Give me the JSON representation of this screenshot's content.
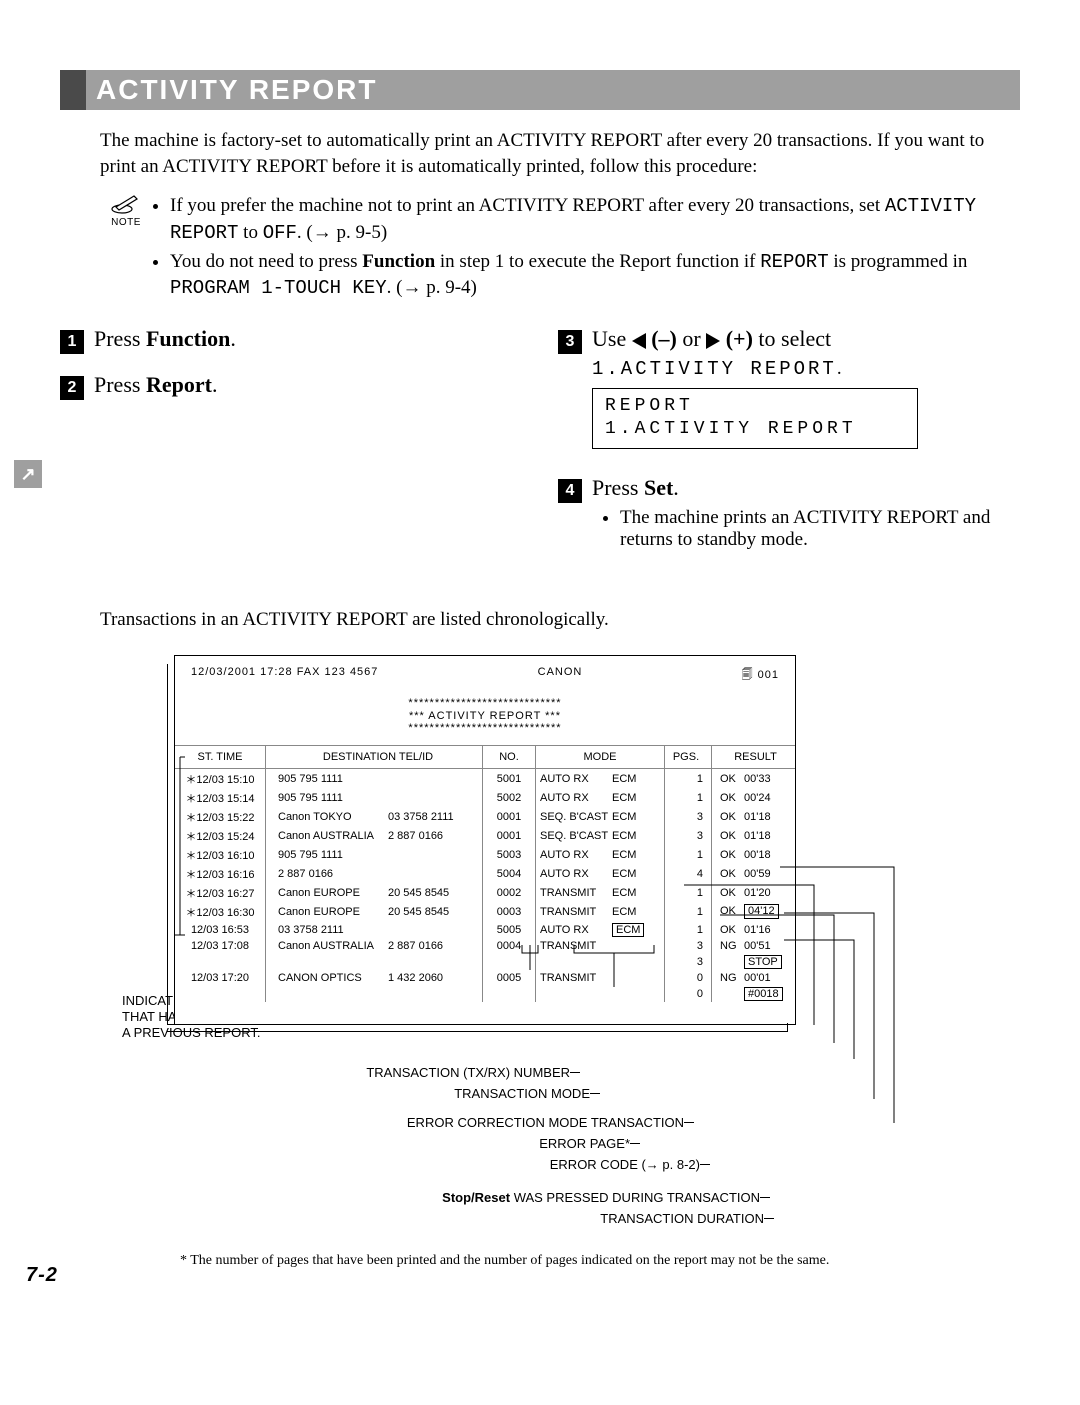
{
  "section_title": "ACTIVITY REPORT",
  "intro": "The machine is factory-set to automatically print an ACTIVITY REPORT after every 20 transactions. If you want to print an ACTIVITY REPORT before it is automatically printed, follow this procedure:",
  "note_label": "NOTE",
  "note_items": [
    {
      "pre": "If you prefer the machine not to print an ACTIVITY REPORT after every 20 transactions, set ",
      "mono": "ACTIVITY REPORT",
      "mid": " to ",
      "mono2": "OFF",
      "post": ". (→ p. 9-5)"
    },
    {
      "pre": "You do not need to press ",
      "bold": "Function",
      "mid": " in step 1 to execute the Report function if ",
      "mono": "REPORT",
      "mid2": " is programmed in ",
      "mono2": "PROGRAM 1-TOUCH KEY",
      "post": ". (→ p. 9-4)"
    }
  ],
  "steps": {
    "s1": {
      "num": "1",
      "pre": "Press ",
      "bold": "Function",
      "post": "."
    },
    "s2": {
      "num": "2",
      "pre": "Press ",
      "bold": "Report",
      "post": "."
    },
    "s3": {
      "num": "3",
      "pre": "Use ",
      "minus": "(–)",
      "or": " or ",
      "plus": "(+)",
      "post": " to select",
      "line2": "1.ACTIVITY REPORT",
      "after": "."
    },
    "s4": {
      "num": "4",
      "pre": "Press ",
      "bold": "Set",
      "post": ".",
      "bullet": "The machine prints an ACTIVITY REPORT and returns to standby mode."
    },
    "lcd_l1": "REPORT",
    "lcd_l2": " 1.ACTIVITY REPORT"
  },
  "chrono": "Transactions in an ACTIVITY REPORT are listed chronologically.",
  "report": {
    "header_left": "12/03/2001  17:28  FAX 123 4567",
    "header_mid": "CANON",
    "header_right": "001",
    "title_stars": "*****************************",
    "title_text": "***    ACTIVITY REPORT    ***",
    "columns": [
      "ST. TIME",
      "DESTINATION TEL/ID",
      "NO.",
      "MODE",
      "PGS.",
      "RESULT"
    ],
    "rows": [
      {
        "st": "＊12/03  15:10",
        "dest": "905 795 1111",
        "tel": "",
        "no": "5001",
        "mode": "AUTO RX",
        "ecm": "ECM",
        "pgs": "1",
        "res": "OK",
        "dur": "00'33"
      },
      {
        "st": "＊12/03  15:14",
        "dest": "905 795 1111",
        "tel": "",
        "no": "5002",
        "mode": "AUTO RX",
        "ecm": "ECM",
        "pgs": "1",
        "res": "OK",
        "dur": "00'24"
      },
      {
        "st": "＊12/03  15:22",
        "dest": "Canon TOKYO",
        "tel": "03 3758 2111",
        "no": "0001",
        "mode": "SEQ. B'CAST",
        "ecm": "ECM",
        "pgs": "3",
        "res": "OK",
        "dur": "01'18"
      },
      {
        "st": "＊12/03  15:24",
        "dest": "Canon AUSTRALIA",
        "tel": "2 887 0166",
        "no": "0001",
        "mode": "SEQ. B'CAST",
        "ecm": "ECM",
        "pgs": "3",
        "res": "OK",
        "dur": "01'18"
      },
      {
        "st": "＊12/03  16:10",
        "dest": "905 795 1111",
        "tel": "",
        "no": "5003",
        "mode": "AUTO RX",
        "ecm": "ECM",
        "pgs": "1",
        "res": "OK",
        "dur": "00'18"
      },
      {
        "st": "＊12/03  16:16",
        "dest": "2 887 0166",
        "tel": "",
        "no": "5004",
        "mode": "AUTO RX",
        "ecm": "ECM",
        "pgs": "4",
        "res": "OK",
        "dur": "00'59"
      },
      {
        "st": "＊12/03  16:27",
        "dest": "Canon EUROPE",
        "tel": "20 545 8545",
        "no": "0002",
        "mode": "TRANSMIT",
        "ecm": "ECM",
        "pgs": "1",
        "res": "OK",
        "dur": "01'20"
      },
      {
        "st": "＊12/03  16:30",
        "dest": "Canon EUROPE",
        "tel": "20 545 8545",
        "no": "0003",
        "mode": "TRANSMIT",
        "ecm": "ECM",
        "pgs": "1",
        "res": "OK",
        "dur": "04'12",
        "dur_boxed": true
      },
      {
        "st": "  12/03  16:53",
        "dest": "03 3758 2111",
        "tel": "",
        "no": "5005",
        "mode": "AUTO RX",
        "ecm": "ECM",
        "ecm_boxed": true,
        "pgs": "1",
        "res": "OK",
        "dur": "01'16"
      },
      {
        "st": "  12/03  17:08",
        "dest": "Canon AUSTRALIA",
        "tel": "2 887 0166",
        "no": "0004",
        "mode": "TRANSMIT",
        "ecm": "",
        "pgs": "3",
        "res": "NG",
        "dur": "00'51"
      },
      {
        "st": "",
        "dest": "",
        "tel": "",
        "no": "",
        "mode": "",
        "ecm": "",
        "pgs": "3",
        "res": "",
        "dur": "STOP",
        "dur_boxed": true
      },
      {
        "st": "  12/03  17:20",
        "dest": "CANON OPTICS",
        "tel": "1 432 2060",
        "no": "0005",
        "mode": "TRANSMIT",
        "ecm": "",
        "pgs": "0",
        "res": "NG",
        "dur": "00'01"
      },
      {
        "st": "",
        "dest": "",
        "tel": "",
        "no": "",
        "mode": "",
        "ecm": "",
        "pgs": "0",
        "res": "",
        "dur": "#0018",
        "dur_boxed": true
      }
    ]
  },
  "callouts": {
    "left": "INDICATES AN ENTRY THAT HAS APPEARED ON A PREVIOUS REPORT.",
    "c1": "TRANSACTION (TX/RX) NUMBER",
    "c2": "TRANSACTION MODE",
    "c3": "ERROR CORRECTION MODE TRANSACTION",
    "c4": "ERROR PAGE*",
    "c5": "ERROR CODE (→ p. 8-2)",
    "c6_pre": "Stop/Reset",
    "c6_post": " WAS PRESSED DURING TRANSACTION",
    "c7": "TRANSACTION DURATION"
  },
  "footnote": "* The number of pages that have been printed and the number of pages indicated on the report may not be the same.",
  "pagenum": "7-2",
  "tab_marker": "↗"
}
